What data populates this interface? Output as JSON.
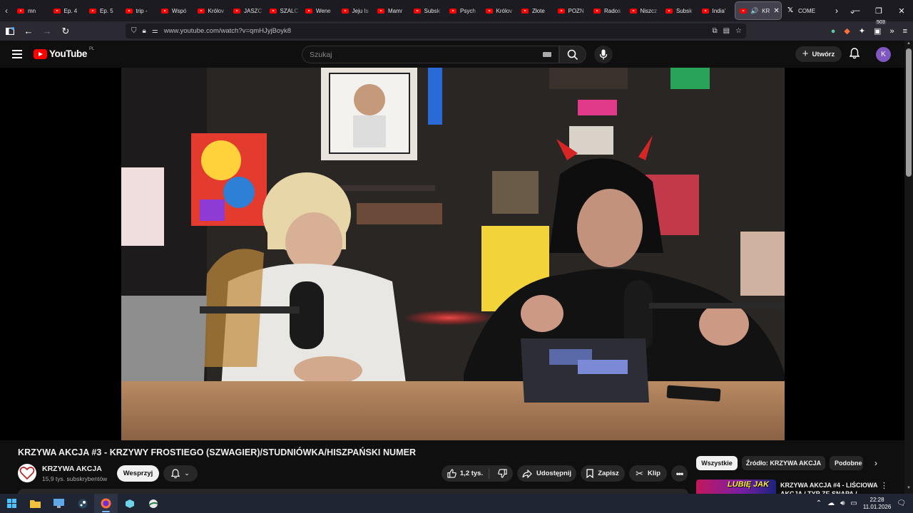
{
  "browser": {
    "tabs": [
      {
        "label": "mn",
        "favicon": "youtube"
      },
      {
        "label": "Ep. 4",
        "favicon": "youtube"
      },
      {
        "label": "Ep. 5",
        "favicon": "youtube"
      },
      {
        "label": "trip -",
        "favicon": "youtube"
      },
      {
        "label": "Wspó",
        "favicon": "youtube"
      },
      {
        "label": "Królov",
        "favicon": "youtube"
      },
      {
        "label": "JASZC",
        "favicon": "youtube"
      },
      {
        "label": "SZALC",
        "favicon": "youtube"
      },
      {
        "label": "Wene",
        "favicon": "youtube"
      },
      {
        "label": "Jeju Is",
        "favicon": "youtube"
      },
      {
        "label": "Mamr",
        "favicon": "youtube"
      },
      {
        "label": "Subsk",
        "favicon": "youtube"
      },
      {
        "label": "Psych",
        "favicon": "youtube"
      },
      {
        "label": "Królov",
        "favicon": "youtube"
      },
      {
        "label": "Złote",
        "favicon": "youtube"
      },
      {
        "label": "POZN",
        "favicon": "youtube"
      },
      {
        "label": "Rados",
        "favicon": "youtube"
      },
      {
        "label": "Niszcz",
        "favicon": "youtube"
      },
      {
        "label": "Subsk",
        "favicon": "youtube"
      },
      {
        "label": "India'",
        "favicon": "youtube"
      }
    ],
    "active_tab": {
      "label": "KR"
    },
    "x_tab": {
      "label": "COME"
    },
    "url": "www.youtube.com/watch?v=qmHJyjBoyk8",
    "extension_badge": "503"
  },
  "youtube": {
    "logo_text": "YouTube",
    "country_code": "PL",
    "search_placeholder": "Szukaj",
    "create_label": "Utwórz",
    "avatar_letter": "K"
  },
  "video": {
    "title": "KRZYWA AKCJA #3 - KRZYWY FROSTIEGO (SZWAGIER)/STUDNIÓWKA/HISZPAŃSKI NUMER",
    "channel_name": "KRZYWA AKCJA",
    "subscribers": "15,9 tys. subskrybentów",
    "support_label": "Wesprzyj",
    "likes": "1,2 tys.",
    "share_label": "Udostępnij",
    "save_label": "Zapisz",
    "clip_label": "Klip"
  },
  "sidebar": {
    "chips": [
      "Wszystkie",
      "Źródło: KRZYWA AKCJA",
      "Podobne"
    ],
    "recommended": {
      "thumb_text": "LUBIĘ JAK",
      "title": "KRZYWA AKCJA #4 - LIŚCIOWA AKCJA / TYP ZE SNAPA /"
    }
  },
  "taskbar": {
    "time": "22:28",
    "date": "11.01.2026"
  }
}
